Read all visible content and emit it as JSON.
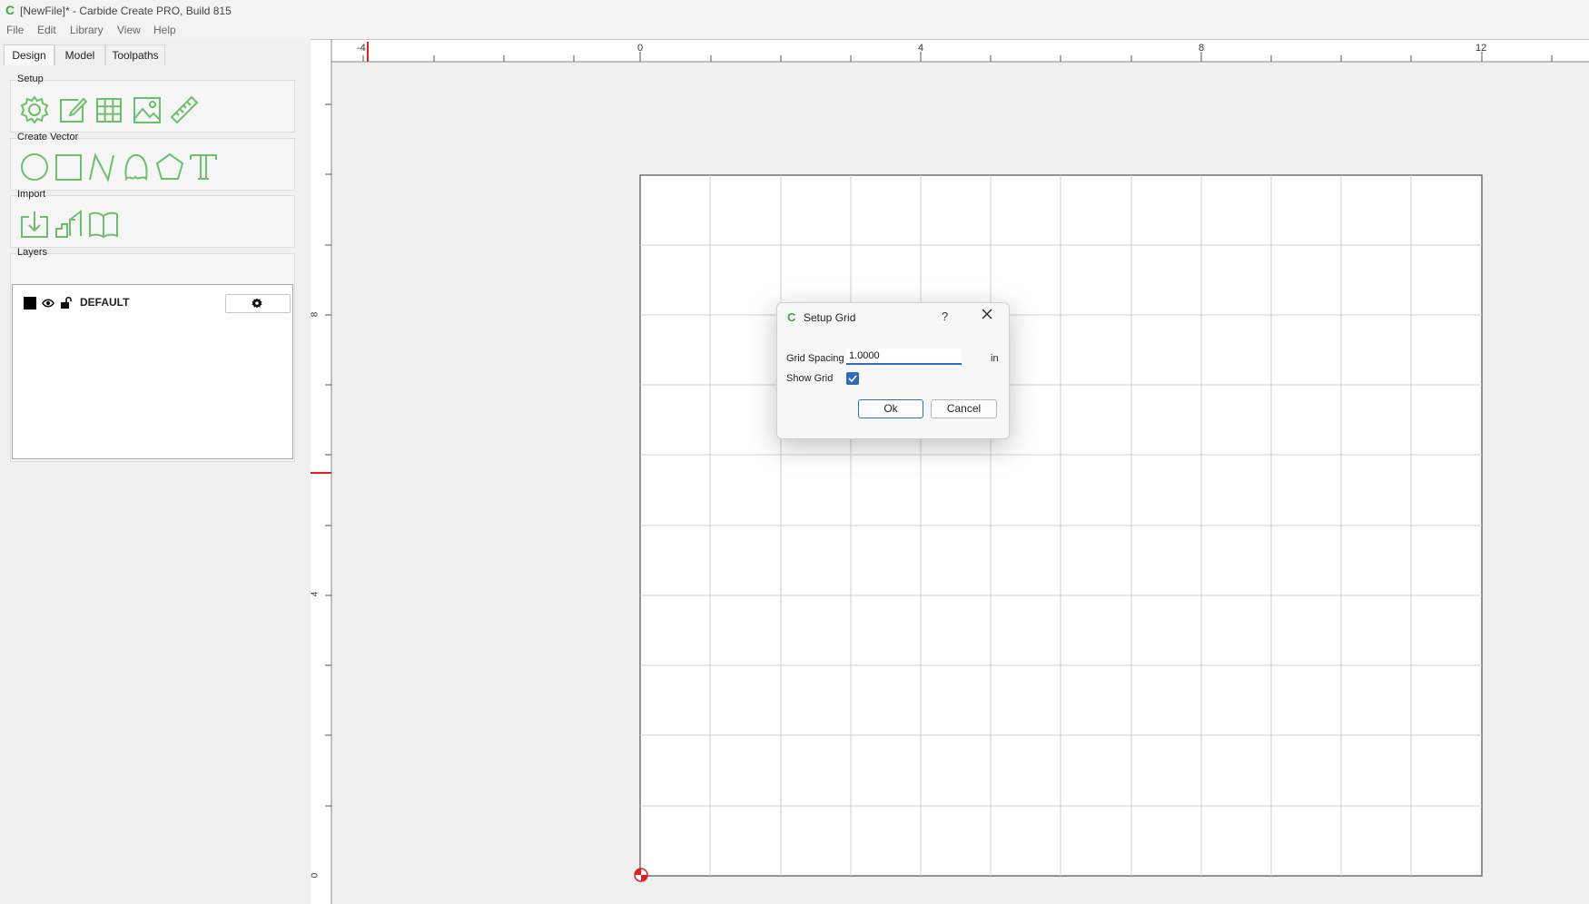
{
  "window": {
    "title": "[NewFile]* - Carbide Create PRO, Build 815",
    "logo_glyph": "C"
  },
  "menu": [
    "File",
    "Edit",
    "Library",
    "View",
    "Help"
  ],
  "tabs": [
    "Design",
    "Model",
    "Toolpaths"
  ],
  "groups": {
    "setup": {
      "label": "Setup",
      "icons": [
        "gear-icon",
        "edit-icon",
        "grid-icon",
        "image-icon",
        "ruler-icon"
      ]
    },
    "create_vector": {
      "label": "Create Vector",
      "icons": [
        "circle-icon",
        "rectangle-icon",
        "polyline-icon",
        "curve-icon",
        "polygon-icon",
        "text-icon"
      ]
    },
    "import": {
      "label": "Import",
      "icons": [
        "import-icon",
        "import-bitmap-icon",
        "library-icon"
      ]
    },
    "layers": {
      "label": "Layers"
    }
  },
  "layers": [
    {
      "name": "DEFAULT",
      "color": "#000000"
    }
  ],
  "ruler": {
    "x_labels": [
      "-4",
      "0",
      "4",
      "8",
      "12"
    ],
    "y_labels": [
      "8",
      "4",
      "0"
    ]
  },
  "dialog": {
    "title": "Setup Grid",
    "help": "?",
    "grid_spacing_label": "Grid Spacing",
    "grid_spacing_value": "1.0000",
    "unit": "in",
    "show_grid_label": "Show Grid",
    "show_grid": true,
    "ok": "Ok",
    "cancel": "Cancel"
  },
  "colors": {
    "accent": "#38a83a",
    "icon": "#6cc06c",
    "focus": "#2e6db5",
    "origin": "#e02020"
  }
}
